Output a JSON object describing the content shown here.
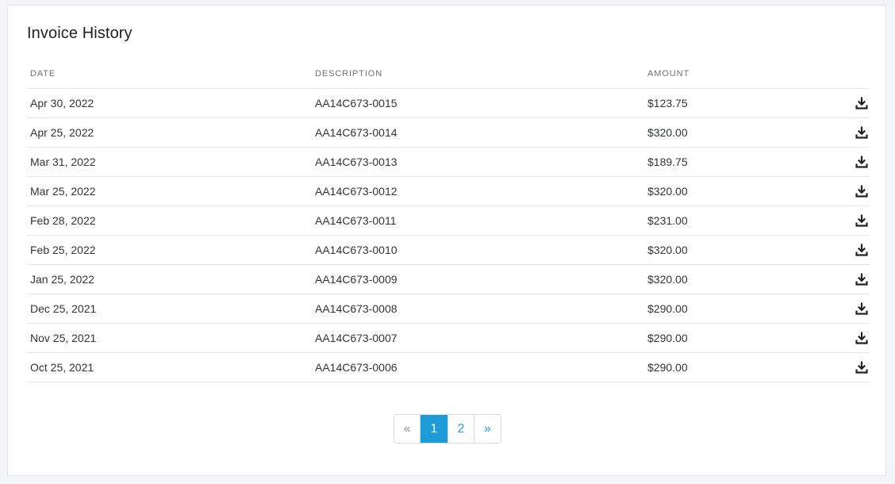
{
  "card": {
    "title": "Invoice History"
  },
  "table": {
    "headers": {
      "date": "DATE",
      "description": "DESCRIPTION",
      "amount": "AMOUNT"
    },
    "rows": [
      {
        "date": "Apr 30, 2022",
        "description": "AA14C673-0015",
        "amount": "$123.75"
      },
      {
        "date": "Apr 25, 2022",
        "description": "AA14C673-0014",
        "amount": "$320.00"
      },
      {
        "date": "Mar 31, 2022",
        "description": "AA14C673-0013",
        "amount": "$189.75"
      },
      {
        "date": "Mar 25, 2022",
        "description": "AA14C673-0012",
        "amount": "$320.00"
      },
      {
        "date": "Feb 28, 2022",
        "description": "AA14C673-0011",
        "amount": "$231.00"
      },
      {
        "date": "Feb 25, 2022",
        "description": "AA14C673-0010",
        "amount": "$320.00"
      },
      {
        "date": "Jan 25, 2022",
        "description": "AA14C673-0009",
        "amount": "$320.00"
      },
      {
        "date": "Dec 25, 2021",
        "description": "AA14C673-0008",
        "amount": "$290.00"
      },
      {
        "date": "Nov 25, 2021",
        "description": "AA14C673-0007",
        "amount": "$290.00"
      },
      {
        "date": "Oct 25, 2021",
        "description": "AA14C673-0006",
        "amount": "$290.00"
      }
    ],
    "row_action_icon": "download-icon"
  },
  "pagination": {
    "prev": "«",
    "pages": [
      "1",
      "2"
    ],
    "current": "1",
    "next": "»"
  },
  "colors": {
    "accent": "#1e9bd7",
    "link": "#2a9bd6",
    "border": "#e3e6ea",
    "background": "#f4f5f8"
  }
}
